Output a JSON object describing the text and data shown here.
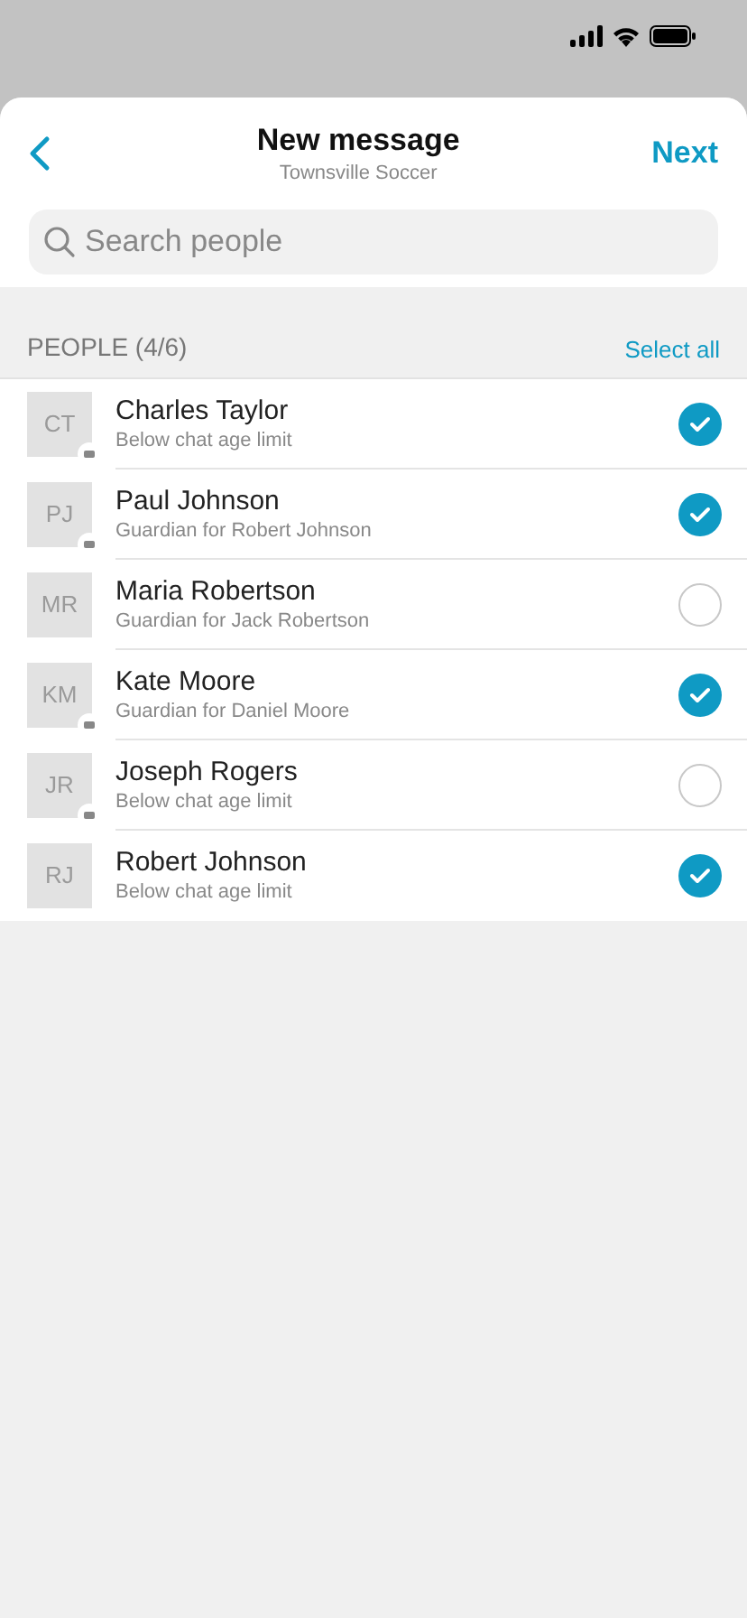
{
  "header": {
    "title": "New message",
    "subtitle": "Townsville Soccer",
    "next": "Next"
  },
  "search": {
    "placeholder": "Search people"
  },
  "section": {
    "title": "PEOPLE (4/6)",
    "action": "Select all"
  },
  "people": [
    {
      "initials": "CT",
      "name": "Charles Taylor",
      "detail": "Below chat age limit",
      "badge": true,
      "selected": true
    },
    {
      "initials": "PJ",
      "name": "Paul Johnson",
      "detail": "Guardian for Robert Johnson",
      "badge": true,
      "selected": true
    },
    {
      "initials": "MR",
      "name": "Maria Robertson",
      "detail": "Guardian for Jack Robertson",
      "badge": false,
      "selected": false
    },
    {
      "initials": "KM",
      "name": "Kate Moore",
      "detail": "Guardian for Daniel Moore",
      "badge": true,
      "selected": true
    },
    {
      "initials": "JR",
      "name": "Joseph Rogers",
      "detail": "Below chat age limit",
      "badge": true,
      "selected": false
    },
    {
      "initials": "RJ",
      "name": "Robert Johnson",
      "detail": "Below chat age limit",
      "badge": false,
      "selected": true
    }
  ]
}
